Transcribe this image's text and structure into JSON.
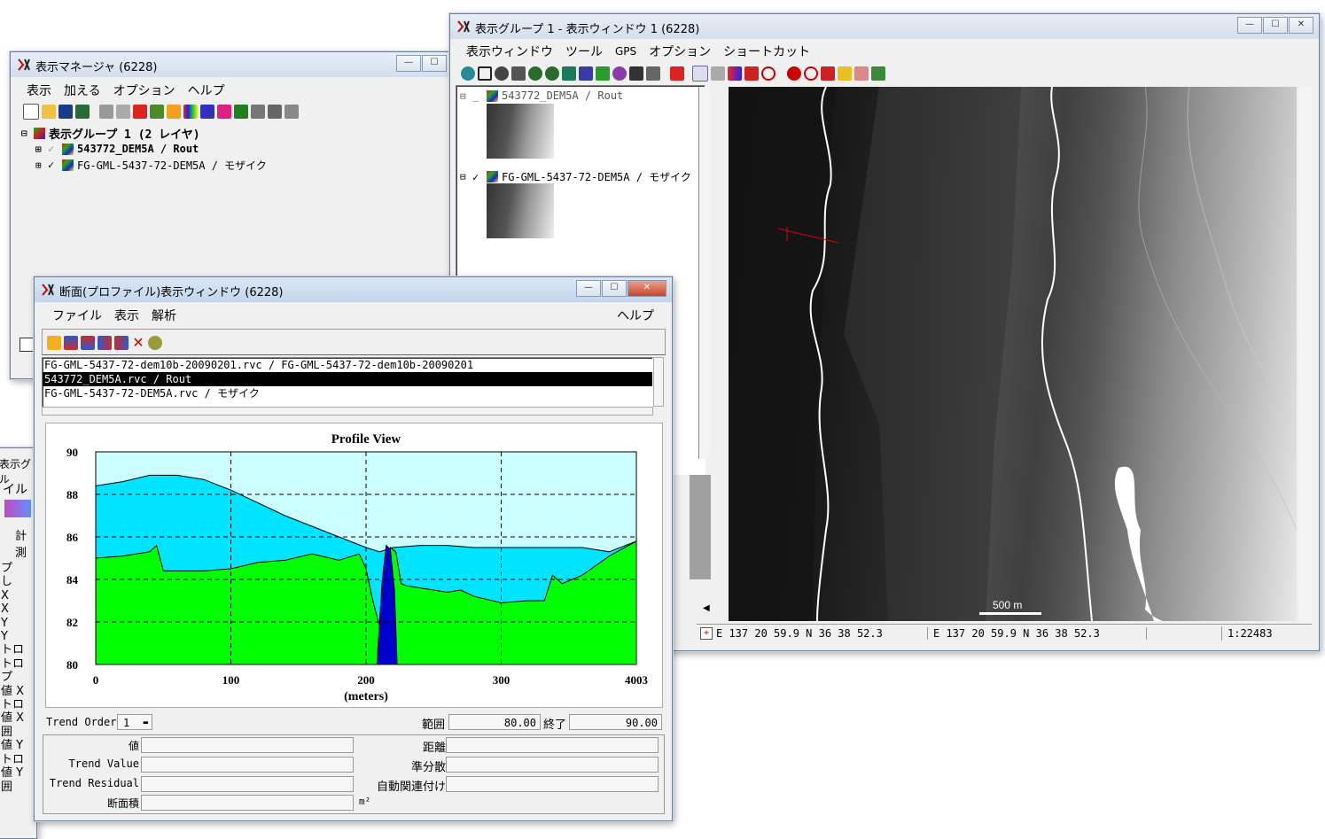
{
  "display_manager": {
    "title": "表示マネージャ (6228)",
    "menu": [
      "表示",
      "加える",
      "オプション",
      "ヘルプ"
    ],
    "group_label": "表示グループ 1  (2 レイヤ)",
    "layers": [
      {
        "name": "543772_DEM5A / Rout",
        "checked": false
      },
      {
        "name": "FG-GML-5437-72-DEM5A / モザイク",
        "checked": true
      }
    ]
  },
  "view_window": {
    "title": "表示グループ 1  - 表示ウィンドウ 1 (6228)",
    "menu": [
      "表示ウィンドウ",
      "ツール",
      "GPS",
      "オプション",
      "ショートカット"
    ],
    "legend_layers": [
      "543772_DEM5A / Rout",
      "FG-GML-5437-72-DEM5A / モザイク"
    ],
    "scale_bar_label": "500 m",
    "status": {
      "coord_1": "E 137 20 59.9  N 36 38 52.3",
      "coord_2": "E 137 20 59.9  N 36 38 52.3",
      "scale": "1:22483"
    }
  },
  "profile_window": {
    "title": "断面(プロファイル)表示ウィンドウ (6228)",
    "menu": [
      "ファイル",
      "表示",
      "解析"
    ],
    "help_menu": "ヘルプ",
    "layer_list": [
      "FG-GML-5437-72-dem10b-20090201.rvc / FG-GML-5437-72-dem10b-20090201",
      "543772_DEM5A.rvc / Rout",
      "FG-GML-5437-72-DEM5A.rvc / モザイク"
    ],
    "selected_index": 1,
    "trend_order_label": "Trend Order",
    "trend_order_value": "1",
    "range_label": "範囲",
    "range_value": "80.00",
    "end_label": "終了",
    "end_value": "90.00",
    "stats_left": [
      "値",
      "Trend Value",
      "Trend Residual",
      "断面積"
    ],
    "stats_right": [
      "距離",
      "準分散",
      "自動関連付け"
    ],
    "area_unit": "m²"
  },
  "background_window": {
    "title_fragment": "表示グル",
    "menu_fragment": "イル",
    "label_fragment": "計測",
    "side_labels": [
      "プ",
      "し",
      "X",
      "X",
      "Y",
      "Y",
      "トロ",
      "トロ",
      "プ",
      "値 X",
      "トロ",
      "値 X",
      "囲",
      "値 Y",
      "トロ",
      "値 Y",
      "囲"
    ]
  },
  "chart_data": {
    "type": "area",
    "title": "Profile View",
    "xlabel": "(meters)",
    "ylabel": "",
    "xlim": [
      0,
      400
    ],
    "ylim": [
      80,
      90
    ],
    "x_ticks": [
      0,
      100,
      200,
      300,
      400
    ],
    "x_tick_labels": [
      "0",
      "100",
      "200",
      "300",
      "4003"
    ],
    "y_ticks": [
      80,
      82,
      84,
      86,
      88,
      90
    ],
    "grid": true,
    "series": [
      {
        "fill": "#00e5ff",
        "x": [
          0,
          20,
          40,
          60,
          80,
          100,
          120,
          140,
          160,
          180,
          200,
          210,
          220,
          240,
          260,
          280,
          300,
          320,
          340,
          360,
          380,
          400
        ],
        "values": [
          88.4,
          88.6,
          88.9,
          88.9,
          88.7,
          88.2,
          87.6,
          87.0,
          86.5,
          86.0,
          85.5,
          85.3,
          85.5,
          85.6,
          85.6,
          85.5,
          85.5,
          85.5,
          85.5,
          85.5,
          85.3,
          85.8
        ]
      },
      {
        "fill": "#00ff00",
        "x": [
          0,
          20,
          40,
          45,
          50,
          60,
          80,
          100,
          120,
          140,
          160,
          180,
          195,
          200,
          205,
          210,
          214,
          218,
          222,
          226,
          230,
          240,
          260,
          270,
          280,
          300,
          320,
          332,
          338,
          345,
          360,
          380,
          400
        ],
        "values": [
          85.0,
          85.1,
          85.3,
          85.6,
          84.4,
          84.4,
          84.4,
          84.5,
          84.8,
          84.9,
          85.2,
          84.9,
          85.2,
          84.5,
          83.0,
          81.8,
          84.5,
          85.5,
          85.3,
          83.8,
          83.7,
          83.6,
          83.4,
          83.5,
          83.2,
          82.9,
          83.0,
          83.0,
          84.2,
          83.8,
          84.2,
          85.1,
          85.8
        ]
      },
      {
        "fill": "#0000cc",
        "x": [
          208,
          212,
          215,
          218,
          221,
          223
        ],
        "values": [
          80,
          84.0,
          85.6,
          85.4,
          83.5,
          80
        ]
      }
    ]
  }
}
